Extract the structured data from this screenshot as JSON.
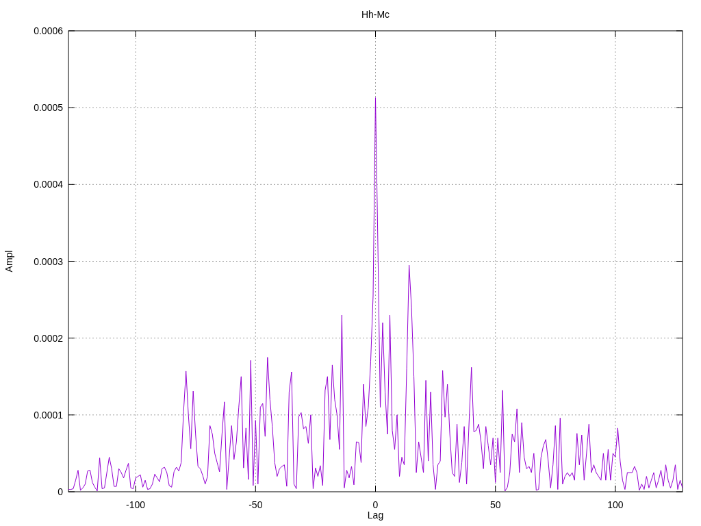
{
  "chart_data": {
    "type": "line",
    "grid": true,
    "title": "Hh-Mc",
    "xlabel": "Lag",
    "ylabel": "Ampl",
    "xlim": [
      -128,
      128
    ],
    "ylim": [
      0,
      0.0006
    ],
    "xticks": [
      -100,
      -50,
      0,
      50,
      100
    ],
    "yticks": [
      {
        "value": 0,
        "label": "0"
      },
      {
        "value": 0.0001,
        "label": "0.0001"
      },
      {
        "value": 0.0002,
        "label": "0.0002"
      },
      {
        "value": 0.0003,
        "label": "0.0003"
      },
      {
        "value": 0.0004,
        "label": "0.0004"
      },
      {
        "value": 0.0005,
        "label": "0.0005"
      },
      {
        "value": 0.0006,
        "label": "0.0006"
      }
    ],
    "x": [
      -128,
      -127,
      -126,
      -125,
      -124,
      -123,
      -122,
      -121,
      -120,
      -119,
      -118,
      -117,
      -116,
      -115,
      -114,
      -113,
      -112,
      -111,
      -110,
      -109,
      -108,
      -107,
      -106,
      -105,
      -104,
      -103,
      -102,
      -101,
      -100,
      -99,
      -98,
      -97,
      -96,
      -95,
      -94,
      -93,
      -92,
      -91,
      -90,
      -89,
      -88,
      -87,
      -86,
      -85,
      -84,
      -83,
      -82,
      -81,
      -80,
      -79,
      -78,
      -77,
      -76,
      -75,
      -74,
      -73,
      -72,
      -71,
      -70,
      -69,
      -68,
      -67,
      -66,
      -65,
      -64,
      -63,
      -62,
      -61,
      -60,
      -59,
      -58,
      -57,
      -56,
      -55,
      -54,
      -53,
      -52,
      -51,
      -50,
      -49,
      -48,
      -47,
      -46,
      -45,
      -44,
      -43,
      -42,
      -41,
      -40,
      -39,
      -38,
      -37,
      -36,
      -35,
      -34,
      -33,
      -32,
      -31,
      -30,
      -29,
      -28,
      -27,
      -26,
      -25,
      -24,
      -23,
      -22,
      -21,
      -20,
      -19,
      -18,
      -17,
      -16,
      -15,
      -14,
      -13,
      -12,
      -11,
      -10,
      -9,
      -8,
      -7,
      -6,
      -5,
      -4,
      -3,
      -2,
      -1,
      0,
      1,
      2,
      3,
      4,
      5,
      6,
      7,
      8,
      9,
      10,
      11,
      12,
      13,
      14,
      15,
      16,
      17,
      18,
      19,
      20,
      21,
      22,
      23,
      24,
      25,
      26,
      27,
      28,
      29,
      30,
      31,
      32,
      33,
      34,
      35,
      36,
      37,
      38,
      39,
      40,
      41,
      42,
      43,
      44,
      45,
      46,
      47,
      48,
      49,
      50,
      51,
      52,
      53,
      54,
      55,
      56,
      57,
      58,
      59,
      60,
      61,
      62,
      63,
      64,
      65,
      66,
      67,
      68,
      69,
      70,
      71,
      72,
      73,
      74,
      75,
      76,
      77,
      78,
      79,
      80,
      81,
      82,
      83,
      84,
      85,
      86,
      87,
      88,
      89,
      90,
      91,
      92,
      93,
      94,
      95,
      96,
      97,
      98,
      99,
      100,
      101,
      102,
      103,
      104,
      105,
      106,
      107,
      108,
      109,
      110,
      111,
      112,
      113,
      114,
      115,
      116,
      117,
      118,
      119,
      120,
      121,
      122,
      123,
      124,
      125,
      126,
      127,
      128
    ],
    "series": [
      {
        "color": "#9400d3",
        "values": [
          3e-06,
          3e-06,
          4e-06,
          1.5e-05,
          2.8e-05,
          2e-06,
          5e-06,
          1e-05,
          2.7e-05,
          2.8e-05,
          1.2e-05,
          6e-06,
          1e-06,
          4.4e-05,
          4e-06,
          5e-06,
          2.5e-05,
          4.5e-05,
          3e-05,
          7e-06,
          7e-06,
          3e-05,
          2.5e-05,
          1.8e-05,
          2.8e-05,
          3.7e-05,
          5e-06,
          4e-06,
          1.8e-05,
          2e-05,
          2.2e-05,
          6e-06,
          1.5e-05,
          3e-06,
          4e-06,
          1e-05,
          2.3e-05,
          1.8e-05,
          1.3e-05,
          3e-05,
          3.2e-05,
          2.5e-05,
          8e-06,
          6e-06,
          2.6e-05,
          3.2e-05,
          2.7e-05,
          3.8e-05,
          0.000105,
          0.000157,
          0.0001,
          5.6e-05,
          0.000131,
          7.5e-05,
          3.3e-05,
          3e-05,
          2.1e-05,
          1e-05,
          2e-05,
          8.6e-05,
          7.5e-05,
          5e-05,
          3.8e-05,
          2.6e-05,
          7.5e-05,
          0.000117,
          3e-06,
          4.5e-05,
          8.6e-05,
          4.2e-05,
          6.5e-05,
          0.00011,
          0.00015,
          3.1e-05,
          8.3e-05,
          1.6e-05,
          0.000171,
          8e-06,
          9.3e-05,
          1e-05,
          0.00011,
          0.000115,
          7.2e-05,
          0.000175,
          0.00012,
          8.5e-05,
          3.8e-05,
          2e-05,
          3e-05,
          3.3e-05,
          3.5e-05,
          7e-06,
          0.00013,
          0.000156,
          1e-05,
          4e-06,
          9.8e-05,
          0.000103,
          8.2e-05,
          8.5e-05,
          6.3e-05,
          0.0001,
          4e-06,
          3.1e-05,
          2e-05,
          3.4e-05,
          8e-06,
          0.000132,
          0.00015,
          6.8e-05,
          0.000165,
          0.00012,
          0.0001,
          5.5e-05,
          0.00023,
          5e-06,
          2.8e-05,
          1.8e-05,
          3.3e-05,
          9e-06,
          6.5e-05,
          6.4e-05,
          3.8e-05,
          0.00014,
          8.5e-05,
          0.00011,
          0.00017,
          0.000255,
          0.000513,
          0.00032,
          0.00011,
          0.00022,
          0.00013,
          7.5e-05,
          0.00023,
          8e-05,
          5.5e-05,
          0.0001,
          2e-05,
          4.5e-05,
          3.5e-05,
          0.00016,
          0.000295,
          0.00024,
          0.00015,
          2.5e-05,
          6.5e-05,
          4.5e-05,
          2.5e-05,
          0.000145,
          4e-05,
          0.00013,
          3.5e-05,
          3e-06,
          3.5e-05,
          4e-05,
          0.000158,
          9.7e-05,
          0.00014,
          7.5e-05,
          2.5e-05,
          2e-05,
          8.8e-05,
          1.2e-05,
          3.8e-05,
          8.5e-05,
          1e-05,
          9e-05,
          0.000162,
          7.8e-05,
          8e-05,
          8.8e-05,
          6.5e-05,
          3e-05,
          8.5e-05,
          6e-05,
          3.5e-05,
          7e-05,
          1.2e-05,
          7e-05,
          2.5e-05,
          0.000132,
          1e-06,
          6e-06,
          2.5e-05,
          7.5e-05,
          6.5e-05,
          0.000108,
          2.5e-05,
          9e-05,
          4.5e-05,
          3e-05,
          3.3e-05,
          2.5e-05,
          5e-05,
          2e-06,
          3e-06,
          4.5e-05,
          6e-05,
          6.8e-05,
          4e-05,
          5e-06,
          3.5e-05,
          8.6e-05,
          3e-06,
          9.6e-05,
          1e-05,
          2e-05,
          2.5e-05,
          2e-05,
          2.5e-05,
          1.5e-05,
          7.6e-05,
          3.5e-05,
          7.4e-05,
          1.5e-05,
          5e-05,
          8.8e-05,
          2.5e-05,
          3.5e-05,
          2.5e-05,
          2e-05,
          1.5e-05,
          5e-05,
          1.5e-05,
          5.5e-05,
          1.5e-05,
          5e-05,
          4.5e-05,
          8.3e-05,
          4e-05,
          1.5e-05,
          3e-06,
          2.5e-05,
          2.5e-05,
          2.5e-05,
          3.3e-05,
          2.5e-05,
          2e-06,
          1e-05,
          3e-06,
          2e-05,
          5e-06,
          1.5e-05,
          2.5e-05,
          5e-06,
          1.5e-05,
          2.8e-05,
          7e-06,
          3.5e-05,
          1.5e-05,
          5e-06,
          1.5e-05,
          3.5e-05,
          3e-06,
          1.5e-05,
          5e-06
        ]
      }
    ]
  }
}
